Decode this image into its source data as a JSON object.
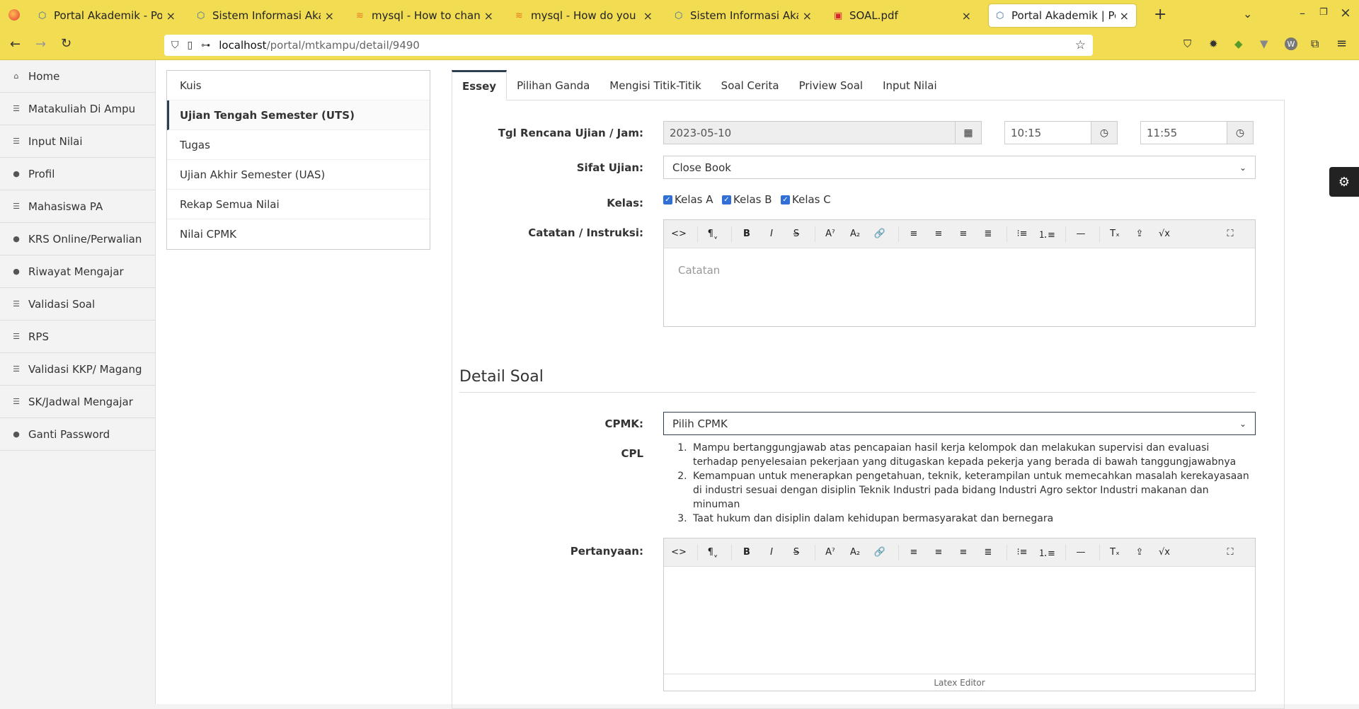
{
  "browser": {
    "tabs": [
      {
        "title": "Portal Akademik - Politek"
      },
      {
        "title": "Sistem Informasi Akadem"
      },
      {
        "title": "mysql - How to change m"
      },
      {
        "title": "mysql - How do you set \"n"
      },
      {
        "title": "Sistem Informasi Akadem"
      },
      {
        "title": "SOAL.pdf"
      },
      {
        "title": "Portal Akademik | Politek"
      }
    ],
    "url_host": "localhost",
    "url_path": "/portal/mtkampu/detail/9490"
  },
  "sidebar": {
    "items": [
      {
        "label": "Home",
        "icon": "home-icon"
      },
      {
        "label": "Matakuliah Di Ampu",
        "icon": "list-icon"
      },
      {
        "label": "Input Nilai",
        "icon": "list-icon"
      },
      {
        "label": "Profil",
        "icon": "user-icon"
      },
      {
        "label": "Mahasiswa PA",
        "icon": "list-icon"
      },
      {
        "label": "KRS Online/Perwalian",
        "icon": "user-icon"
      },
      {
        "label": "Riwayat Mengajar",
        "icon": "user-icon"
      },
      {
        "label": "Validasi Soal",
        "icon": "list-icon"
      },
      {
        "label": "RPS",
        "icon": "list-icon"
      },
      {
        "label": "Validasi KKP/ Magang",
        "icon": "list-icon"
      },
      {
        "label": "SK/Jadwal Mengajar",
        "icon": "list-icon"
      },
      {
        "label": "Ganti Password",
        "icon": "user-icon"
      }
    ]
  },
  "submenu": {
    "items": [
      {
        "label": "Kuis"
      },
      {
        "label": "Ujian Tengah Semester (UTS)"
      },
      {
        "label": "Tugas"
      },
      {
        "label": "Ujian Akhir Semester (UAS)"
      },
      {
        "label": "Rekap Semua Nilai"
      },
      {
        "label": "Nilai CPMK"
      }
    ]
  },
  "tabs": [
    {
      "label": "Essey"
    },
    {
      "label": "Pilihan Ganda"
    },
    {
      "label": "Mengisi Titik-Titik"
    },
    {
      "label": "Soal Cerita"
    },
    {
      "label": "Priview Soal"
    },
    {
      "label": "Input Nilai"
    }
  ],
  "form": {
    "tgl_label": "Tgl Rencana Ujian / Jam:",
    "tgl_value": "2023-05-10",
    "jam_mulai": "10:15",
    "jam_selesai": "11:55",
    "sifat_label": "Sifat Ujian:",
    "sifat_value": "Close Book",
    "kelas_label": "Kelas:",
    "kelas": [
      "Kelas A",
      "Kelas B",
      "Kelas C"
    ],
    "catatan_label": "Catatan / Instruksi:",
    "catatan_placeholder": "Catatan",
    "detail_title": "Detail Soal",
    "cpmk_label": "CPMK:",
    "cpmk_value": "Pilih CPMK",
    "cpl_label": "CPL",
    "cpl": [
      "Mampu bertanggungjawab atas pencapaian hasil kerja kelompok dan melakukan supervisi dan evaluasi terhadap penyelesaian pekerjaan yang ditugaskan kepada pekerja yang berada di bawah tanggungjawabnya",
      "Kemampuan untuk menerapkan pengetahuan, teknik, keterampilan untuk memecahkan masalah kerekayasaan di industri sesuai dengan disiplin Teknik Industri pada bidang Industri Agro sektor Industri makanan dan minuman",
      "Taat hukum dan disiplin dalam kehidupan bermasyarakat dan bernegara"
    ],
    "pertanyaan_label": "Pertanyaan:",
    "latex_label": "Latex Editor"
  }
}
